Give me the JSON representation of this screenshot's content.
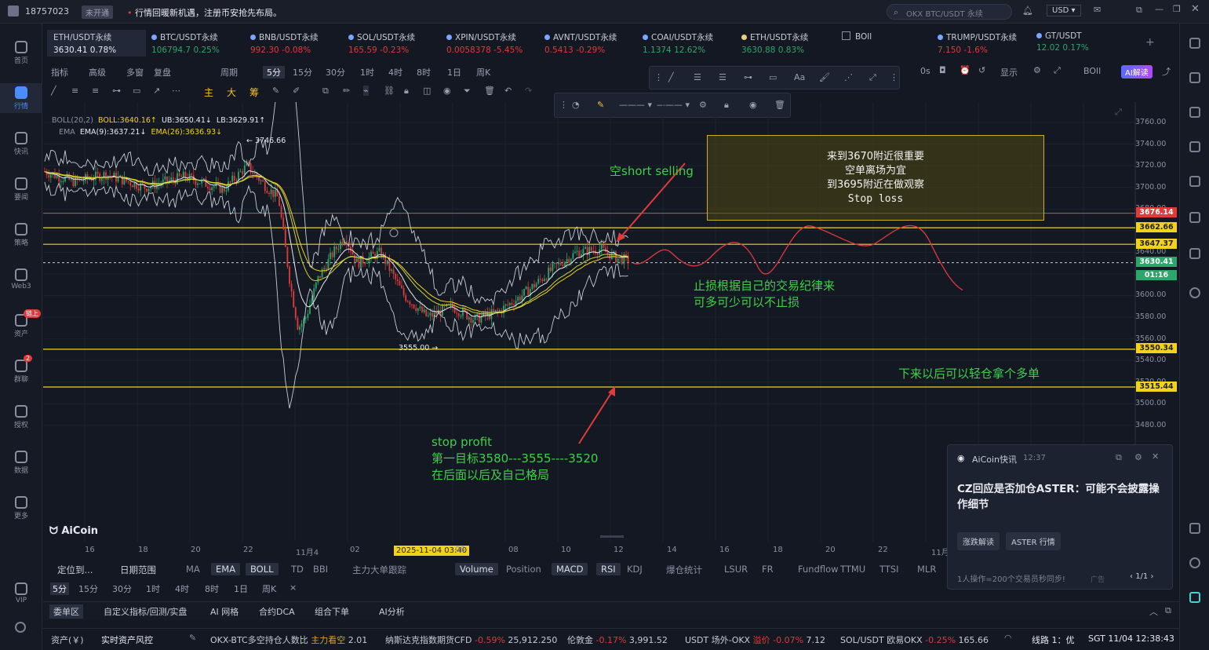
{
  "topbar": {
    "user_id": "18757023",
    "status_badge": "未开通",
    "notice": "行情回暖新机遇，注册币安抢先布局。",
    "search_placeholder": "OKX BTC/USDT 永续",
    "currency": "USD"
  },
  "left_nav": [
    {
      "label": "首页",
      "icon": "home-icon"
    },
    {
      "label": "行情",
      "icon": "chart-icon",
      "active": true
    },
    {
      "label": "快讯",
      "icon": "news-icon"
    },
    {
      "label": "要闻",
      "icon": "document-icon"
    },
    {
      "label": "策略",
      "icon": "robot-icon"
    },
    {
      "label": "Web3",
      "icon": "web3-icon"
    },
    {
      "label": "资产",
      "icon": "wallet-icon",
      "badge": "链上"
    },
    {
      "label": "群聊",
      "icon": "chat-icon",
      "badge": "2"
    },
    {
      "label": "授权",
      "icon": "key-icon"
    },
    {
      "label": "数据",
      "icon": "data-icon"
    },
    {
      "label": "更多",
      "icon": "grid-icon"
    },
    {
      "label": "VIP",
      "icon": "vip-icon"
    }
  ],
  "tickers": [
    {
      "name": "ETH/USDT永续",
      "price": "3630.41",
      "change": "0.78%",
      "up": true,
      "active": true
    },
    {
      "name": "BTC/USDT永续",
      "price": "106794.7",
      "change": "0.25%",
      "up": true
    },
    {
      "name": "BNB/USDT永续",
      "price": "992.30",
      "change": "-0.08%",
      "up": false
    },
    {
      "name": "SOL/USDT永续",
      "price": "165.59",
      "change": "-0.23%",
      "up": false
    },
    {
      "name": "XPIN/USDT永续",
      "price": "0.0058378",
      "change": "-5.45%",
      "up": false
    },
    {
      "name": "AVNT/USDT永续",
      "price": "0.5413",
      "change": "-0.29%",
      "up": false
    },
    {
      "name": "COAI/USDT永续",
      "price": "1.1374",
      "change": "12.62%",
      "up": true
    },
    {
      "name": "ETH/USDT永续",
      "price": "3630.88",
      "change": "0.83%",
      "up": true
    },
    {
      "name": "BOll",
      "price": "",
      "change": "",
      "up": true
    },
    {
      "name": "TRUMP/USDT永续",
      "price": "7.150",
      "change": "-1.6%",
      "up": false
    },
    {
      "name": "GT/USDT",
      "price": "12.02",
      "change": "0.17%",
      "up": true
    }
  ],
  "toolbar": {
    "items": [
      "指标",
      "高级",
      "多窗",
      "复盘",
      "周期",
      "5分",
      "15分",
      "30分",
      "1时",
      "4时",
      "8时",
      "1日",
      "周K"
    ],
    "right": [
      "0s",
      "显示",
      "BOll",
      "AI解读"
    ],
    "draw": [
      "主",
      "大",
      "筹"
    ]
  },
  "legend": {
    "boll": "BOLL(20,2)",
    "boll_mid": "BOLL:3640.16↑",
    "boll_ub": "UB:3650.41↓",
    "boll_lb": "LB:3629.91↑",
    "ema": "EMA",
    "ema9": "EMA(9):3637.21↓",
    "ema26": "EMA(26):3636.93↓"
  },
  "annotations": {
    "short": "空short selling",
    "box_lines": [
      "来到3670附近很重要",
      "空单离场为宜",
      "到3695附近在做观察",
      "Stop  loss"
    ],
    "stop_note": [
      "止损根据自己的交易纪律来",
      "可多可少可以不止损"
    ],
    "long_note": "下来以后可以轻仓拿个多单",
    "profit": [
      "stop profit",
      "第一目标3580---3555----3520",
      "在后面以后及自己格局"
    ],
    "high": "← 3746.66",
    "low": "3555.00 →",
    "watermark": "AiCoin"
  },
  "price_labels": [
    {
      "v": "3676.14",
      "c": "r"
    },
    {
      "v": "3662.66",
      "c": "y"
    },
    {
      "v": "3647.37",
      "c": "y"
    },
    {
      "v": "3630.41",
      "c": "g"
    },
    {
      "v": "01:16",
      "c": "g"
    },
    {
      "v": "3550.34",
      "c": "y"
    },
    {
      "v": "3515.44",
      "c": "y"
    }
  ],
  "y_ticks": [
    "3760.00",
    "3740.00",
    "3720.00",
    "3700.00",
    "3680.00",
    "3660.00",
    "3640.00",
    "3620.00",
    "3600.00",
    "3580.00",
    "3560.00",
    "3540.00",
    "3520.00",
    "3500.00",
    "3480.00"
  ],
  "x_ticks": [
    "16",
    "18",
    "20",
    "22",
    "11月4",
    "02",
    "2025-11-04 03:40",
    "06",
    "08",
    "10",
    "12",
    "14",
    "16",
    "18",
    "20",
    "22",
    "11月5"
  ],
  "indicators": {
    "left": [
      "定位到...",
      "日期范围"
    ],
    "main": [
      "MA",
      "EMA",
      "BOLL",
      "TD",
      "BBI",
      "主力大单跟踪"
    ],
    "sub": [
      "Volume",
      "Position",
      "MACD",
      "RSI",
      "KDJ",
      "爆仓统计",
      "LSUR",
      "FR",
      "Fundflow",
      "TTMU",
      "TTSI",
      "MLR"
    ],
    "on": [
      "EMA",
      "BOLL",
      "Volume",
      "MACD",
      "RSI"
    ]
  },
  "periods": [
    "5分",
    "15分",
    "30分",
    "1时",
    "4时",
    "8时",
    "1日",
    "周K",
    "×"
  ],
  "bottom_tabs": [
    "委单区",
    "自定义指标/回测/实盘",
    "AI 网格",
    "合约DCA",
    "组合下单",
    "AI分析"
  ],
  "status": {
    "left": [
      "资产(￥)",
      "实时资产风控"
    ],
    "items": [
      {
        "name": "OKX-BTC多空持仓人数比",
        "tag": "主力看空",
        "val": "2.01"
      },
      {
        "name": "纳斯达克指数期货CFD",
        "tag": "-0.59%",
        "val": "25,912.250"
      },
      {
        "name": "伦敦金",
        "tag": "-0.17%",
        "val": "3,991.52"
      },
      {
        "name": "USDT 场外-OKX",
        "tag": "溢价 -0.07%",
        "val": "7.12"
      },
      {
        "name": "SOL/USDT 欧易OKX",
        "tag": "-0.25%",
        "val": "165.66"
      }
    ],
    "line": "线路 1：优",
    "time": "SGT 11/04 12:38:43"
  },
  "news": {
    "source": "AiCoin快讯",
    "time": "12:37",
    "title": "CZ回应是否加仓ASTER：可能不会披露操作细节",
    "tags": [
      "涨跌解读",
      "ASTER 行情"
    ],
    "footer": "1人操作=200个交易员秒同步!",
    "ad": "广告",
    "page": "1/1"
  }
}
